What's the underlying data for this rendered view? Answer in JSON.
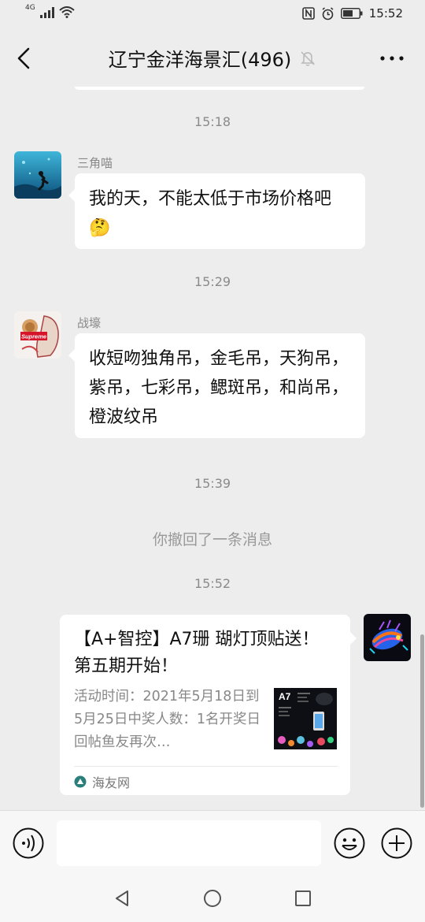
{
  "status": {
    "network": "4G",
    "time": "15:52"
  },
  "header": {
    "title": "辽宁金洋海景汇(496)",
    "back_icon": "back-icon",
    "mute_icon": "bell-off-icon",
    "more_icon": "more-icon"
  },
  "messages": [
    {
      "type": "time",
      "text": "15:18"
    },
    {
      "type": "text",
      "sender": "三角喵",
      "text": "我的天，不能太低于市场价格吧🤔"
    },
    {
      "type": "time",
      "text": "15:29"
    },
    {
      "type": "text",
      "sender": "战壕",
      "text": "收短吻独角吊，金毛吊，天狗吊，紫吊，七彩吊，鳃斑吊，和尚吊，橙波纹吊",
      "avatar_text": "Supreme"
    },
    {
      "type": "time",
      "text": "15:39"
    },
    {
      "type": "recall",
      "text": "你撤回了一条消息"
    },
    {
      "type": "time",
      "text": "15:52"
    },
    {
      "type": "link_card",
      "title": "【A+智控】A7珊 瑚灯顶贴送！第五期开始！",
      "description": "活动时间：2021年5月18日到5月25日中奖人数：1名开奖日回帖鱼友再次…",
      "thumb_text": "A7",
      "source": "海友网"
    }
  ],
  "input": {
    "placeholder": "",
    "voice_icon": "voice-icon",
    "emoji_icon": "emoji-icon",
    "plus_icon": "plus-icon"
  },
  "colors": {
    "background": "#ededed",
    "bubble": "#ffffff",
    "time_text": "#8a8a8a"
  }
}
